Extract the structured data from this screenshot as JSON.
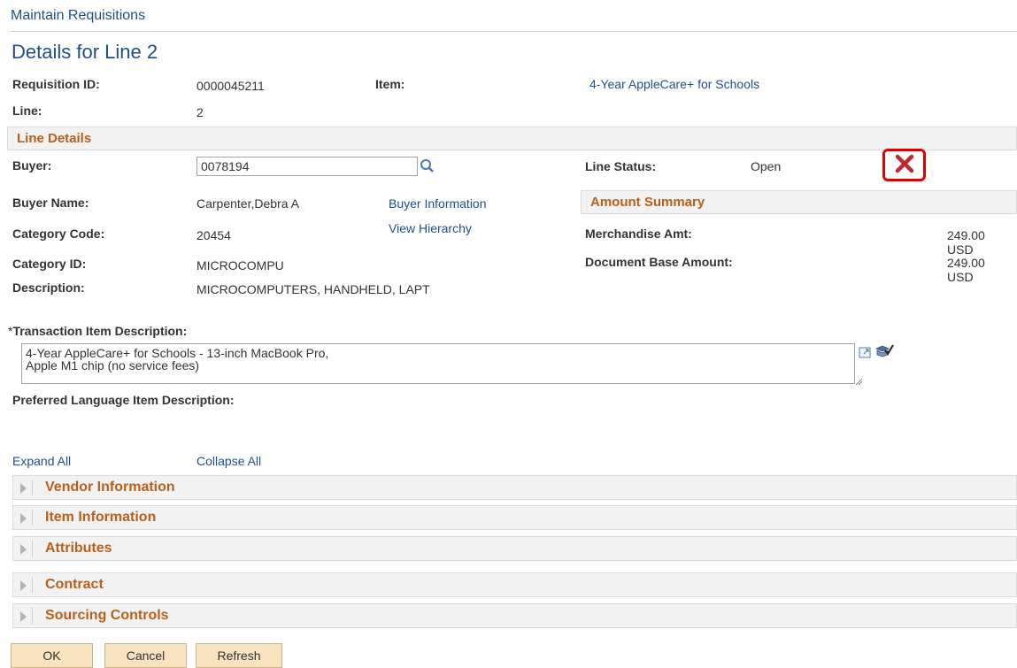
{
  "breadcrumb": "Maintain Requisitions",
  "page_title": "Details for Line 2",
  "header": {
    "requisition_label": "Requisition ID:",
    "requisition_value": "0000045211",
    "item_label": "Item:",
    "item_value": "4-Year AppleCare+ for Schools",
    "line_label": "Line:",
    "line_value": "2"
  },
  "line_details": {
    "title": "Line Details",
    "buyer_label": "Buyer:",
    "buyer_value": "0078194",
    "buyer_name_label": "Buyer Name:",
    "buyer_name_value": "Carpenter,Debra A",
    "buyer_info_link": "Buyer Information",
    "category_code_label": "Category Code:",
    "category_code_value": "20454",
    "view_hierarchy_link": "View Hierarchy",
    "category_id_label": "Category ID:",
    "category_id_value": "MICROCOMPU",
    "description_label": "Description:",
    "description_value": "MICROCOMPUTERS, HANDHELD, LAPT",
    "line_status_label": "Line Status:",
    "line_status_value": "Open"
  },
  "amount_summary": {
    "title": "Amount Summary",
    "merch_label": "Merchandise Amt:",
    "merch_value": "249.00",
    "merch_currency": "USD",
    "base_label": "Document Base Amount:",
    "base_value": "249.00",
    "base_currency": "USD"
  },
  "transaction": {
    "required_mark": "*",
    "label": "Transaction Item Description:",
    "value": "4-Year AppleCare+ for Schools - 13-inch MacBook Pro,\nApple M1 chip (no service fees)",
    "preferred_label": "Preferred Language Item Description:"
  },
  "expand_all": "Expand All",
  "collapse_all": "Collapse All",
  "sections": [
    "Vendor Information",
    "Item Information",
    "Attributes",
    "Contract",
    "Sourcing Controls"
  ],
  "buttons": {
    "ok": "OK",
    "cancel": "Cancel",
    "refresh": "Refresh"
  },
  "icons": {
    "search": "magnifier-icon",
    "close": "close-x-icon",
    "expand_text": "expand-text-icon",
    "spellcheck": "spellcheck-icon"
  },
  "colors": {
    "link": "#1f4e8c",
    "section_title": "#b8601a",
    "close_x": "#c0282d",
    "highlight": "#e00000",
    "button_bg": "#f7e3c0"
  }
}
